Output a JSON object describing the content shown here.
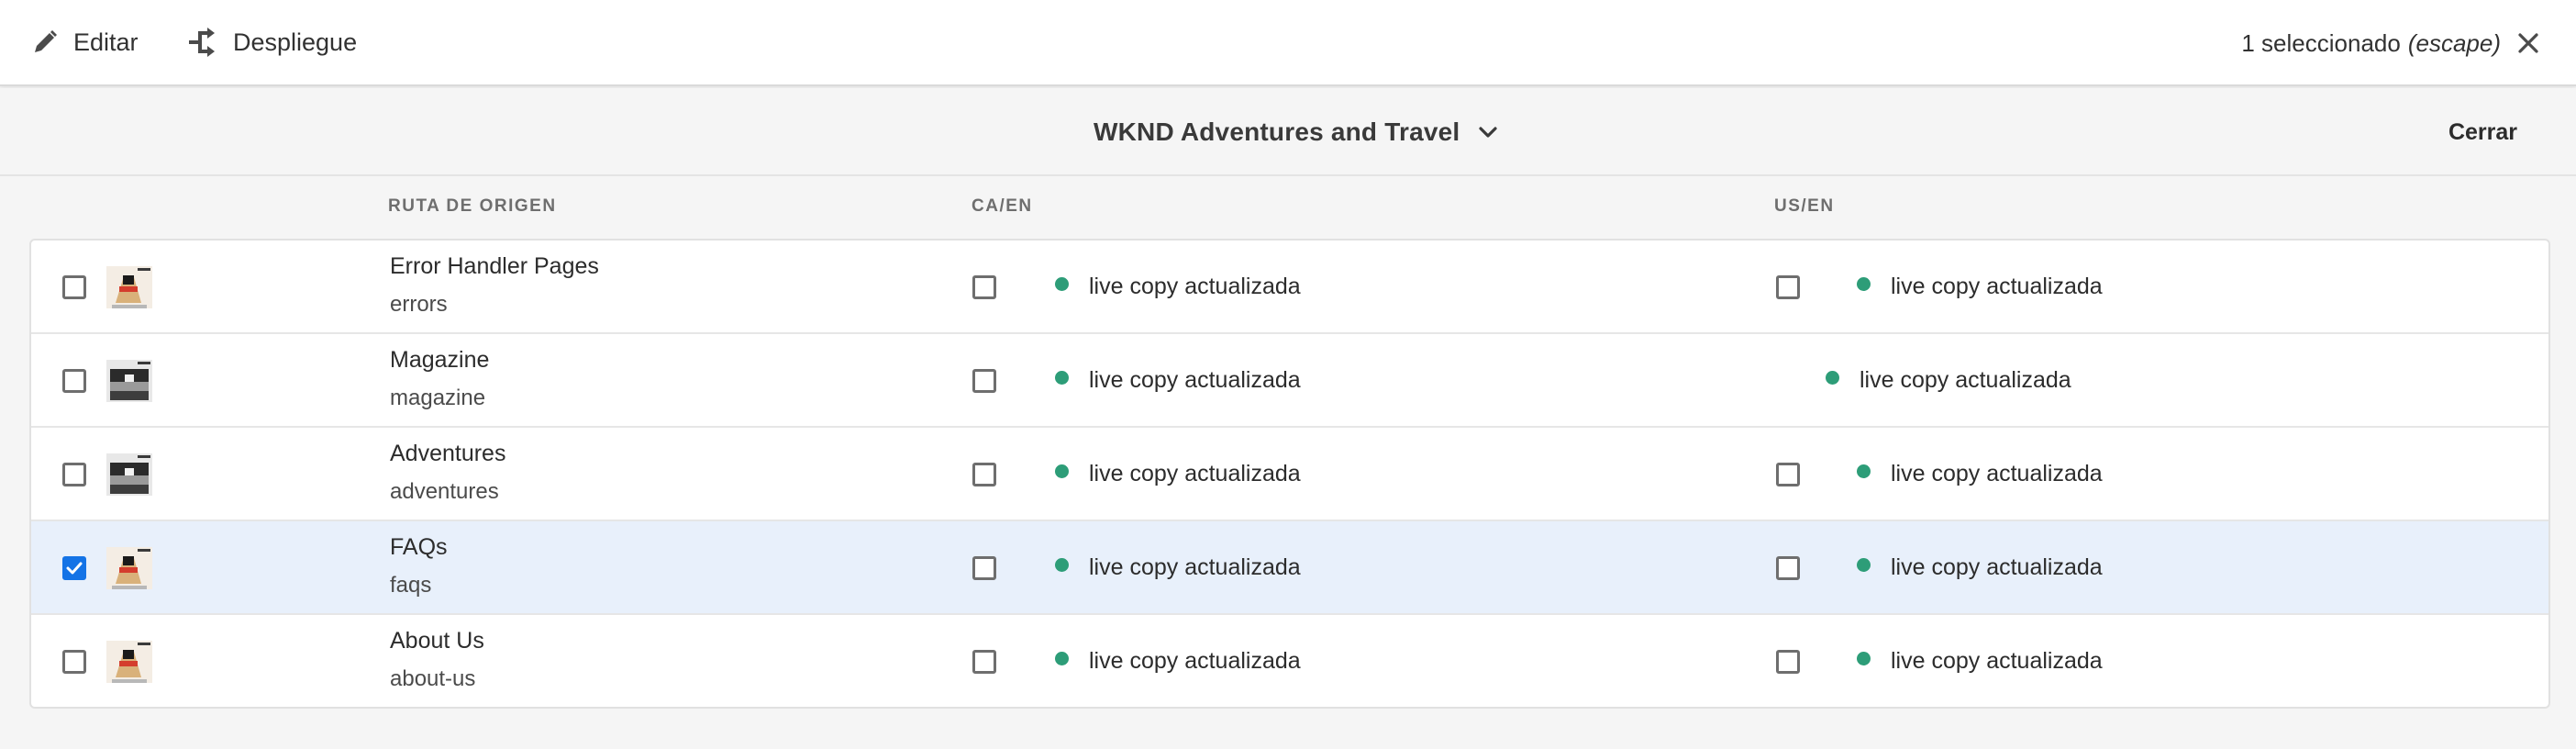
{
  "toolbar": {
    "edit_label": "Editar",
    "deploy_label": "Despliegue",
    "selection_count": "1 seleccionado",
    "selection_hint": "(escape)"
  },
  "header": {
    "title": "WKND Adventures and Travel",
    "close_label": "Cerrar"
  },
  "columns": {
    "source_path": "RUTA DE ORIGEN",
    "ca": "CA/EN",
    "us": "US/EN"
  },
  "rows": [
    {
      "name": "Error Handler Pages",
      "path": "errors",
      "selected": false,
      "ca_status": "live copy actualizada",
      "us_status": "live copy actualizada",
      "us_checkbox": true
    },
    {
      "name": "Magazine",
      "path": "magazine",
      "selected": false,
      "ca_status": "live copy actualizada",
      "us_status": "live copy actualizada",
      "us_checkbox": false
    },
    {
      "name": "Adventures",
      "path": "adventures",
      "selected": false,
      "ca_status": "live copy actualizada",
      "us_status": "live copy actualizada",
      "us_checkbox": true
    },
    {
      "name": "FAQs",
      "path": "faqs",
      "selected": true,
      "ca_status": "live copy actualizada",
      "us_status": "live copy actualizada",
      "us_checkbox": true
    },
    {
      "name": "About Us",
      "path": "about-us",
      "selected": false,
      "ca_status": "live copy actualizada",
      "us_status": "live copy actualizada",
      "us_checkbox": true
    }
  ],
  "colors": {
    "status_ok": "#2d9d78",
    "accent": "#1473e6",
    "selected_row": "#e8f0fb"
  },
  "icons": {
    "edit": "pencil-icon",
    "deploy": "rollout-icon",
    "close": "close-icon",
    "dropdown": "chevron-down-icon",
    "status": "status-dot-icon",
    "check": "checkmark-icon"
  }
}
